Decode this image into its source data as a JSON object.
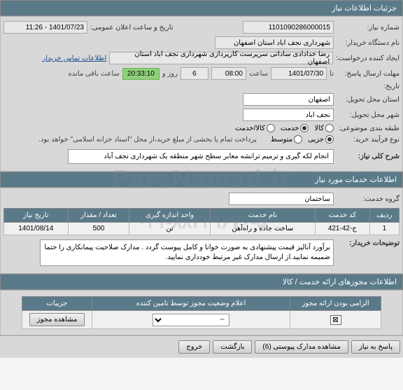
{
  "watermark": "ParsNamad.ir",
  "watermark_phone": "۰۲۱-۸۸۴۲۹۶۷۰-۵",
  "headers": {
    "need_details": "جزئیات اطلاعات نیاز",
    "need_services": "اطلاعات خدمات مورد نیاز",
    "permit_info": "اطلاعات مجوزهای ارائه خدمت / کالا"
  },
  "fields": {
    "need_number_label": "شماره نیاز:",
    "need_number_value": "1101090286000015",
    "announce_label": "تاریخ و ساعت اعلان عمومی:",
    "announce_value": "1401/07/23 - 11:26",
    "buyer_label": "نام دستگاه خریدار:",
    "buyer_value": "شهرداری نجف اباد استان اصفهان",
    "creator_label": "ایجاد کننده درخواست:",
    "creator_value": "رضا خدادادی ساداتی سرپرست  کارپردازی شهرداری نجف اباد استان اصفهان",
    "contact_link": "اطلاعات تماس خریدار",
    "deadline_label": "مهلت ارسال پاسخ:",
    "deadline_ta": "تا",
    "deadline_date": "1401/07/30",
    "deadline_saat": "ساعت",
    "deadline_time": "08:00",
    "days_val": "6",
    "days_label": "روز و",
    "remain_time": "20:33:10",
    "remain_label": "ساعت باقی مانده",
    "tarikh_label": "تاریخ:",
    "province_label": "استان محل تحویل:",
    "province_value": "اصفهان",
    "city_label": "شهر محل تحویل:",
    "city_value": "نجف آباد",
    "category_label": "طبقه بندی موضوعی:",
    "cat_kala": "کالا",
    "cat_khadmat": "خدمت",
    "cat_kala_khadmat": "کالا/خدمت",
    "purchase_type_label": "نوع فرآیند خرید:",
    "pt_joze": "جزیی",
    "pt_motavasset": "متوسط",
    "payment_note": "پرداخت تمام یا بخشی از مبلغ خرید،از محل \"اسناد خزانه اسلامی\" خواهد بود.",
    "desc_label": "شرح کلی نیاز:",
    "desc_value": "انجام لکه گیری و ترمیم ترانشه معابر سطح شهر منطقه یک شهرداری نجف آباد",
    "service_group_label": "گروه خدمت:",
    "service_group_value": "ساختمان"
  },
  "service_table": {
    "headers": [
      "ردیف",
      "کد خدمت",
      "نام خدمت",
      "واحد اندازه گیری",
      "تعداد / مقدار",
      "تاریخ نیاز"
    ],
    "row": {
      "idx": "1",
      "code": "ج-42-421",
      "name": "ساخت جاده و راه‌آهن",
      "unit": "تن",
      "qty": "500",
      "date": "1401/08/14"
    }
  },
  "remarks_label": "توضیحات خریدار:",
  "remarks_value": "برآورد آنالیز قیمت پیشنهادی به صورت خوانا و کامل پیوست گردد . مدارک صلاحیت پیمانکاری را حتما ضمیمه نمایید.از ارسال مدارک غیر مرتبط خودداری نمایید.",
  "permit_table": {
    "headers": [
      "الزامی بودن ارائه مجوز",
      "اعلام وضعیت مجوز توسط تامین کننده",
      "جزییات"
    ],
    "row": {
      "check": "⊠",
      "status_placeholder": "--",
      "detail_btn": "مشاهده مجوز"
    }
  },
  "buttons": {
    "reply": "پاسخ به نیاز",
    "attachments": "مشاهده مدارک پیوستی (6)",
    "back": "بازگشت",
    "exit": "خروج"
  }
}
